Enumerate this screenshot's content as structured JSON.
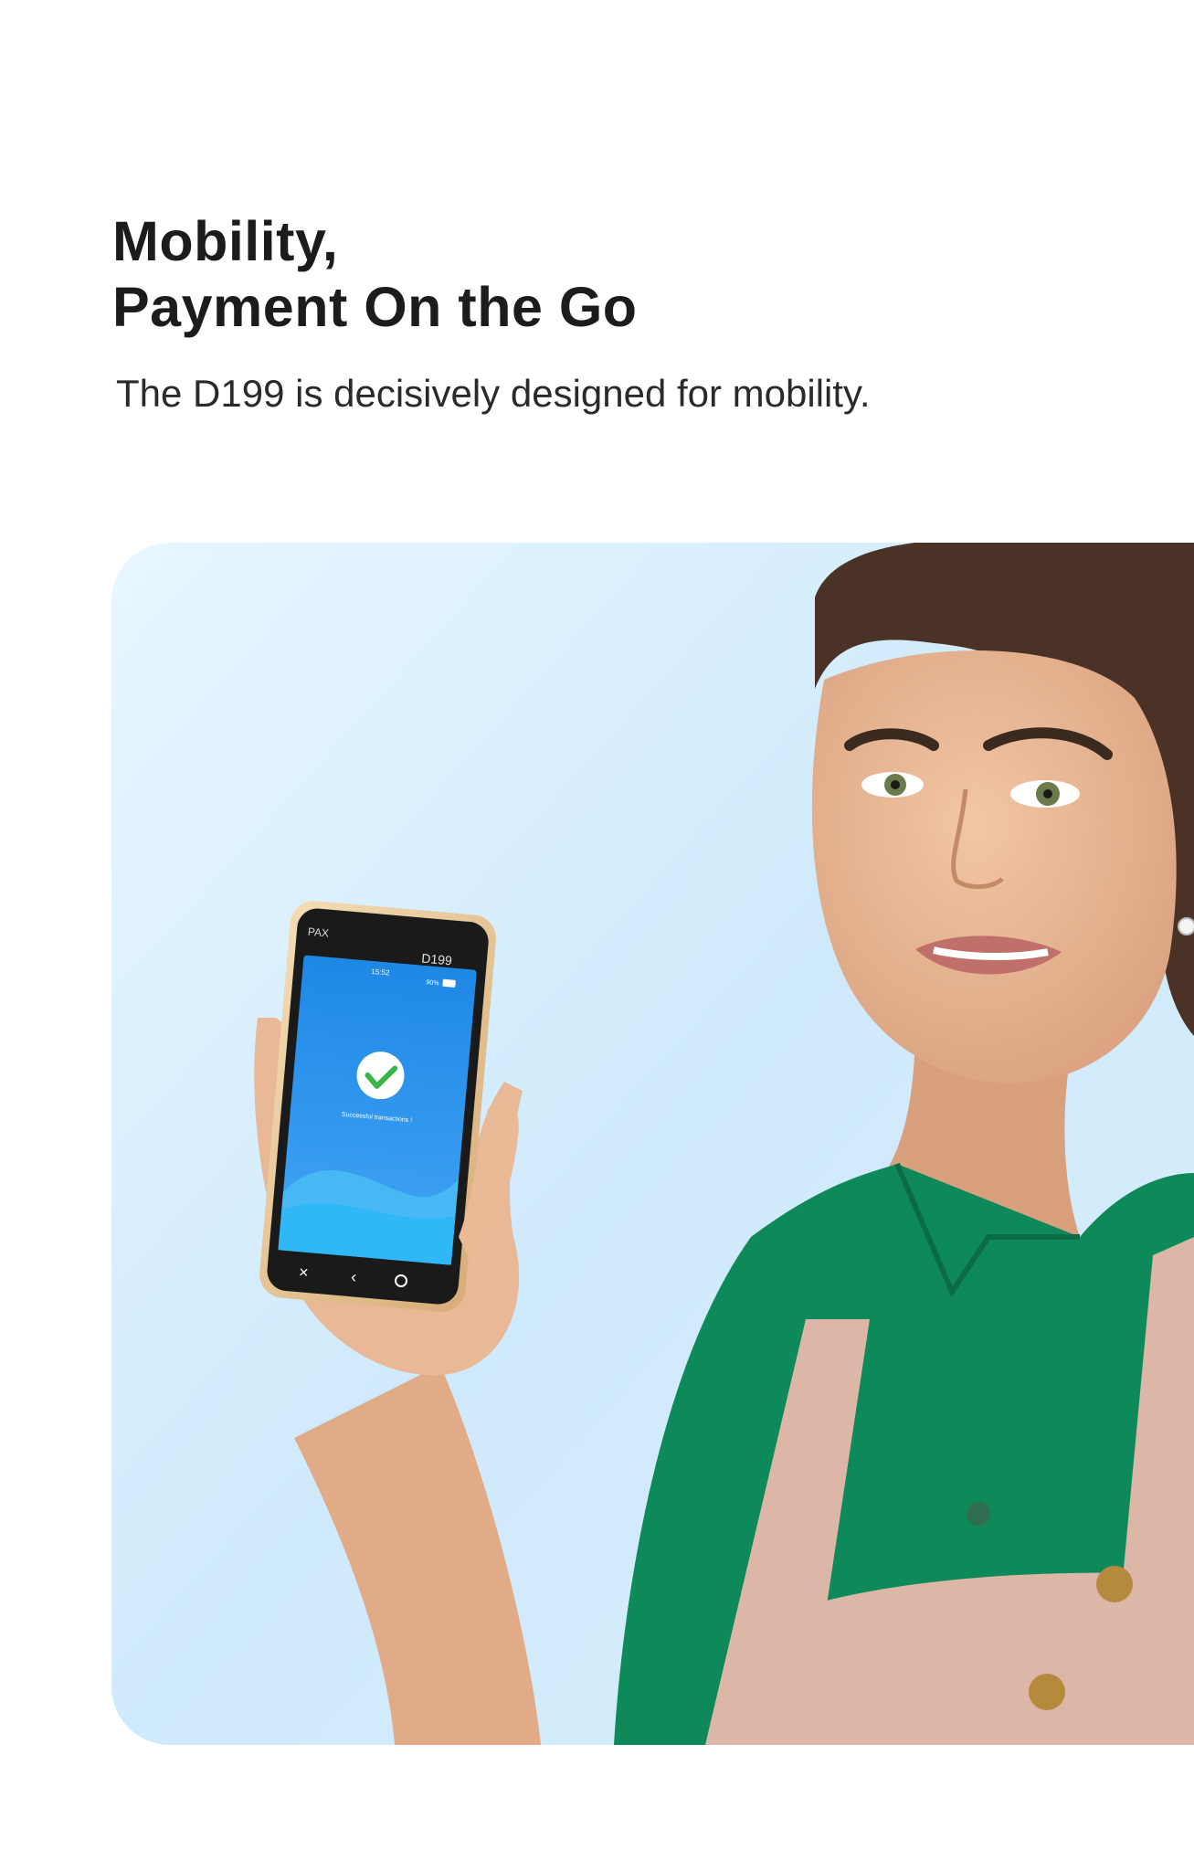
{
  "heading": {
    "line1": "Mobility,",
    "line2": "Payment On the Go"
  },
  "subtitle": "The D199 is decisively designed for mobility.",
  "device": {
    "model": "D199",
    "clock": "15:52",
    "battery": "90%",
    "status_message": "Successful transactions !"
  },
  "colors": {
    "background_light": "#e3f3fe",
    "background_mid": "#c7e7fb",
    "shirt": "#0e8a5a",
    "apron": "#dcb6a6",
    "device_frame": "#e8c79a",
    "screen_blue": "#2196f3",
    "check_green": "#3bb54a"
  }
}
